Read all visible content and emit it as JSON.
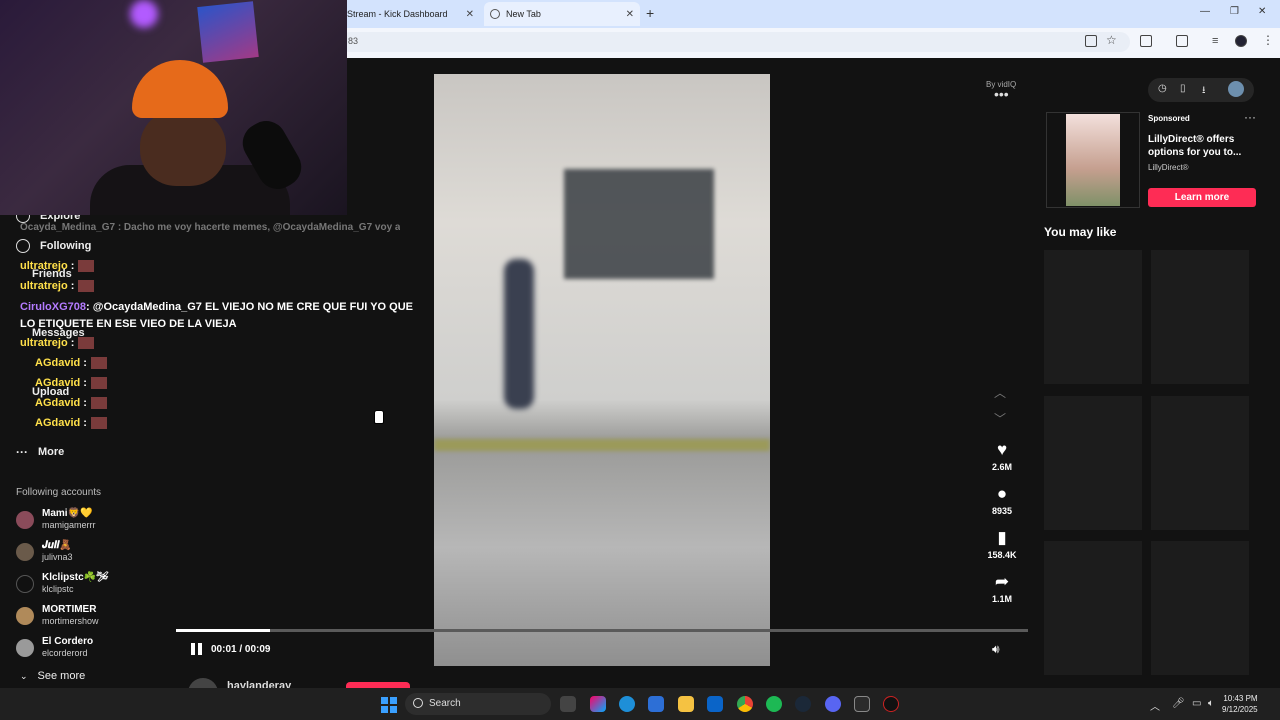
{
  "browser": {
    "tabs": [
      {
        "title": "Stream - Kick Dashboard"
      },
      {
        "title": "New Tab"
      }
    ],
    "address_fragment": "83"
  },
  "sidebar": {
    "nav": [
      {
        "label": "Explore",
        "icon": "compass-icon"
      },
      {
        "label": "Following",
        "icon": "following-icon"
      },
      {
        "label": "Friends",
        "icon": "friends-icon"
      },
      {
        "label": "Messages",
        "icon": "messages-icon"
      },
      {
        "label": "Upload",
        "icon": "upload-icon"
      },
      {
        "label": "More",
        "icon": "more-icon"
      }
    ],
    "following_title": "Following accounts",
    "accounts": [
      {
        "name": "Mami🦁💛",
        "handle": "mamigamerrr"
      },
      {
        "name": "𝑱𝒖𝒍𝒊🧸",
        "handle": "julivna3"
      },
      {
        "name": "Klclipstc☘️🛩",
        "handle": "klclipstc"
      },
      {
        "name": "MORTIMER",
        "handle": "mortimershow"
      },
      {
        "name": "El Cordero",
        "handle": "elcorderord"
      }
    ],
    "see_more": "See more"
  },
  "chat_overlay": {
    "faded_line": "Ocayda_Medina_G7 : Dacho me voy hacerte memes, @OcaydaMedina_G7 voy a",
    "messages": [
      {
        "nick": "ultratrejo",
        "sep": " :"
      },
      {
        "nick": "ultratrejo",
        "sep": " :"
      },
      {
        "nick": "CiruloXG708",
        "text": ": @OcaydaMedina_G7 EL VIEJO NO ME CRE QUE FUI YO QUE LO ETIQUETE EN ESE VIEO DE LA VIEJA"
      },
      {
        "nick": "ultratrejo",
        "sep": " :"
      },
      {
        "nick": "AGdavid",
        "sep": " :"
      },
      {
        "nick": "AGdavid",
        "sep": " :"
      },
      {
        "nick": "AGdavid",
        "sep": " :"
      },
      {
        "nick": "AGdavid",
        "sep": " :"
      }
    ]
  },
  "player": {
    "by_vidiq": "By vidIQ",
    "likes": "2.6M",
    "comments": "8935",
    "saves": "158.4K",
    "shares": "1.1M",
    "time": "00:01 / 00:09",
    "progress_fraction": 0.11,
    "author": "haylanderay"
  },
  "right": {
    "sponsored": "Sponsored",
    "ad_title": "LillyDirect® offers options for you to...",
    "ad_brand": "LillyDirect®",
    "learn_more": "Learn more",
    "you_may_like": "You may like"
  },
  "taskbar": {
    "search_placeholder": "Search",
    "time": "10:43 PM",
    "date": "9/12/2025"
  },
  "colors": {
    "accent": "#fe2c55",
    "chat_nick": "#ffe04a"
  }
}
